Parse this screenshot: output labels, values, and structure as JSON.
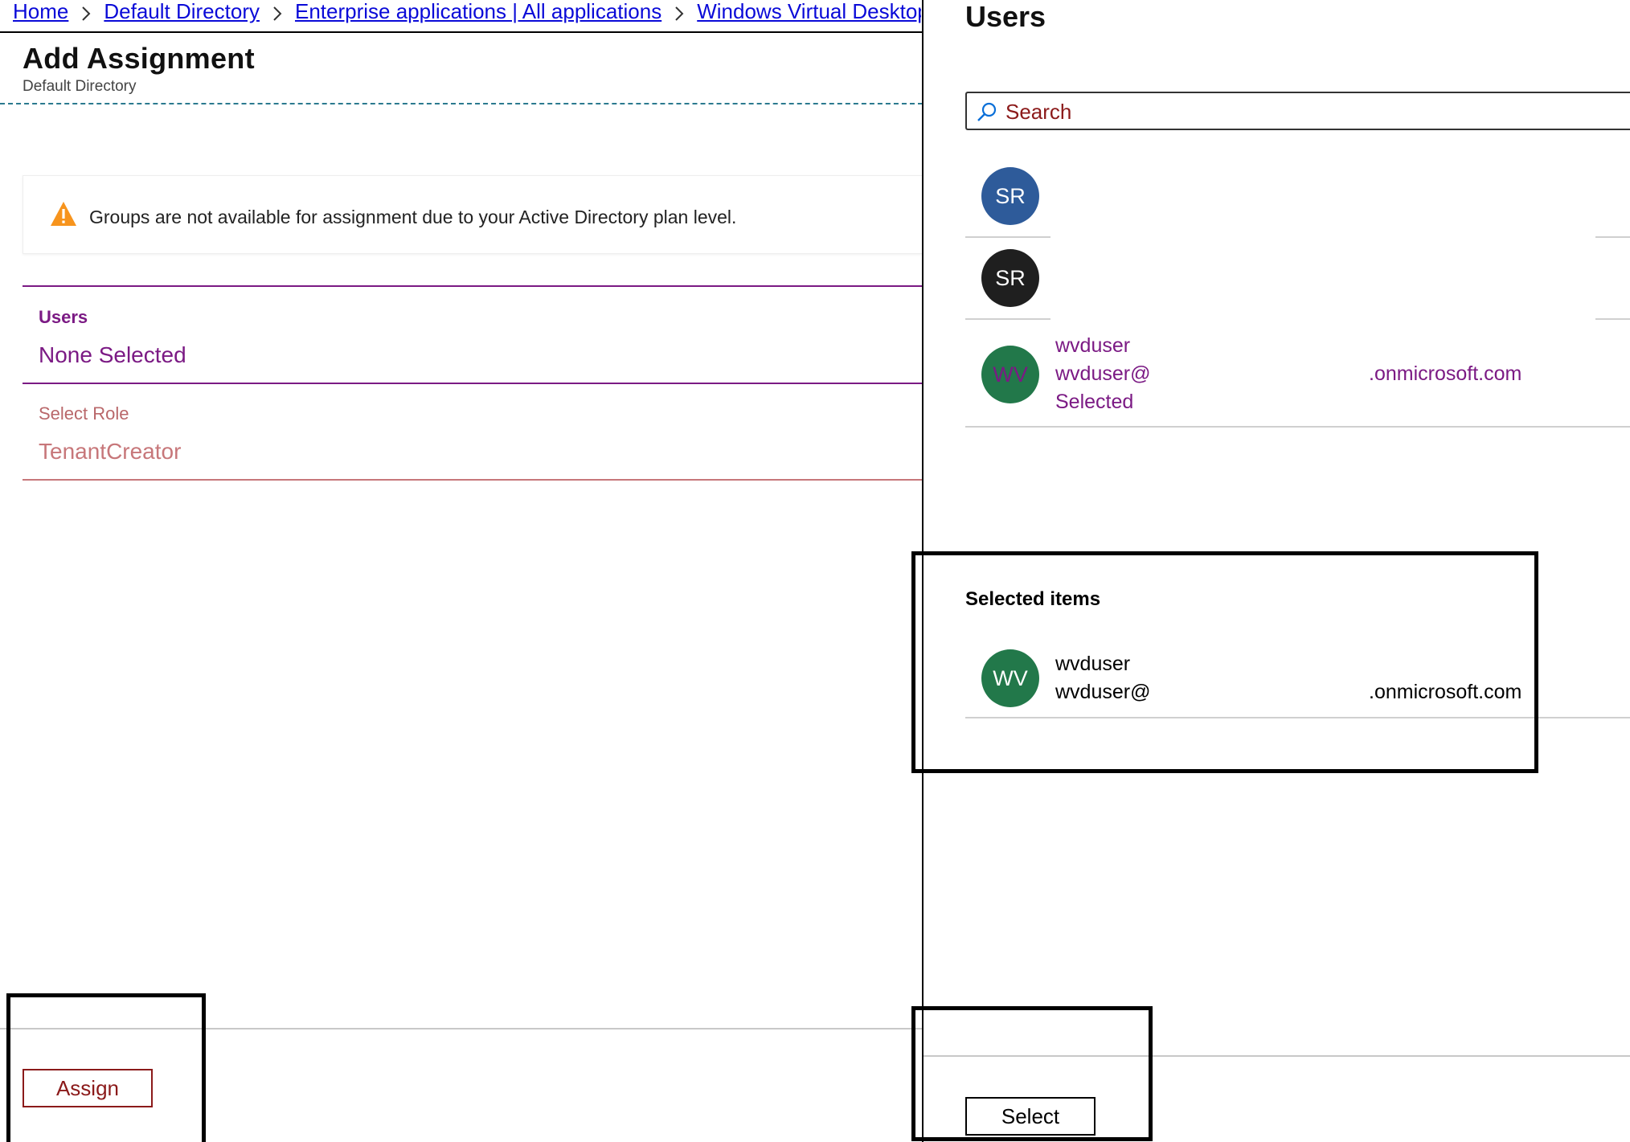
{
  "breadcrumb": [
    {
      "label": "Home"
    },
    {
      "label": "Default Directory"
    },
    {
      "label": "Enterprise applications | All applications"
    },
    {
      "label": "Windows Virtual Desktop"
    }
  ],
  "assignment": {
    "title": "Add Assignment",
    "subtitle": "Default Directory",
    "warning_text": "Groups are not available for assignment due to your Active Directory plan level.",
    "users_label": "Users",
    "users_value": "None Selected",
    "role_label": "Select Role",
    "role_value": "TenantCreator",
    "assign_label": "Assign"
  },
  "users_panel": {
    "title": "Users",
    "search_placeholder": "Search",
    "results": [
      {
        "initials": "SR",
        "avatar_color": "#2e5b9a"
      },
      {
        "initials": "SR",
        "avatar_color": "#1f1f1f"
      },
      {
        "initials": "WV",
        "avatar_color": "#22784a",
        "name": "wvduser",
        "email": "wvduser@",
        "domain": ".onmicrosoft.com",
        "status": "Selected"
      }
    ],
    "selected_title": "Selected items",
    "selected": [
      {
        "initials": "WV",
        "avatar_color": "#22784a",
        "name": "wvduser",
        "email": "wvduser@",
        "domain": ".onmicrosoft.com"
      }
    ],
    "select_label": "Select"
  },
  "colors": {
    "accent_purple": "#7b1a84",
    "role_muted": "#c7777a",
    "button_red": "#8b1a1a",
    "link_blue": "#0a0ad8",
    "warning_orange": "#f7941d"
  }
}
